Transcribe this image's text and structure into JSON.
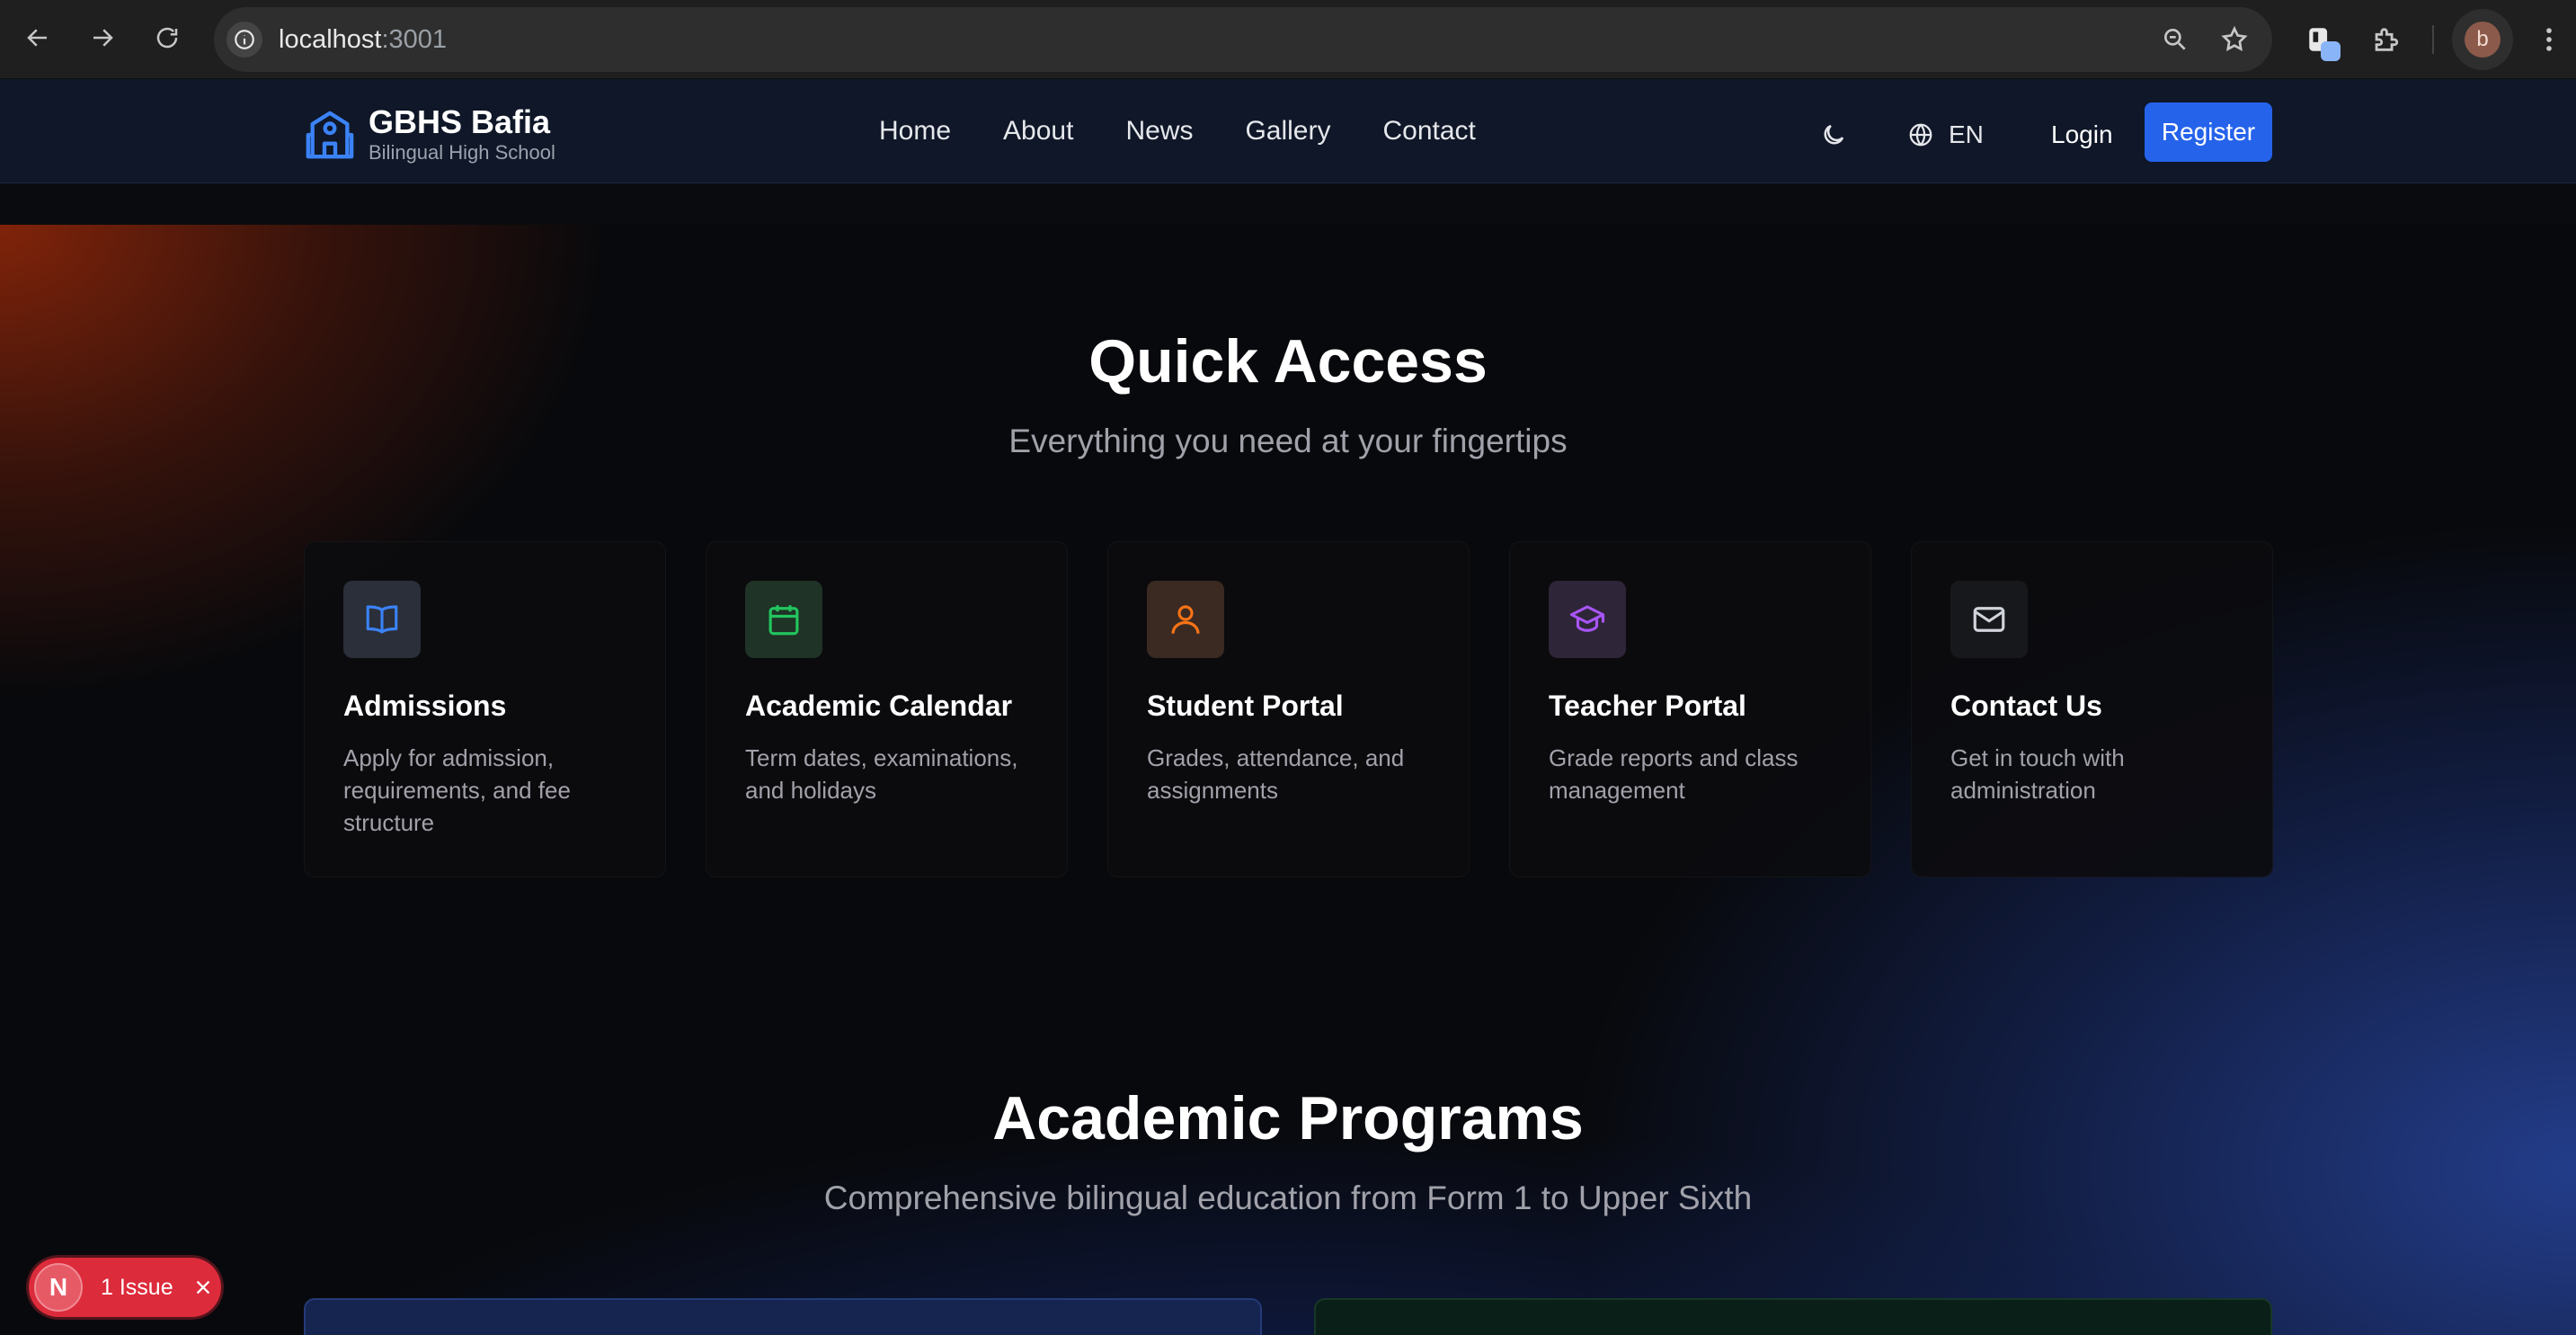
{
  "browser": {
    "url_host": "localhost",
    "url_port": ":3001",
    "profile_initial": "b"
  },
  "header": {
    "brand_name": "GBHS Bafia",
    "brand_subtitle": "Bilingual High School",
    "nav": [
      "Home",
      "About",
      "News",
      "Gallery",
      "Contact"
    ],
    "language": "EN",
    "login_label": "Login",
    "register_label": "Register",
    "register_color": "#2563eb"
  },
  "quick_access": {
    "title": "Quick Access",
    "subtitle": "Everything you need at your fingertips",
    "cards": [
      {
        "title": "Admissions",
        "description": "Apply for admission, requirements, and fee structure",
        "icon": "book-icon",
        "accent": "#3b82f6"
      },
      {
        "title": "Academic Calendar",
        "description": "Term dates, examinations, and holidays",
        "icon": "calendar-icon",
        "accent": "#22c55e"
      },
      {
        "title": "Student Portal",
        "description": "Grades, attendance, and assignments",
        "icon": "user-icon",
        "accent": "#f97316"
      },
      {
        "title": "Teacher Portal",
        "description": "Grade reports and class management",
        "icon": "graduation-cap-icon",
        "accent": "#a855f7"
      },
      {
        "title": "Contact Us",
        "description": "Get in touch with administration",
        "icon": "mail-icon",
        "accent": "#9ca3af"
      }
    ]
  },
  "academic_programs": {
    "title": "Academic Programs",
    "subtitle": "Comprehensive bilingual education from Form 1 to Upper Sixth"
  },
  "dev_overlay": {
    "logo_letter": "N",
    "issue_text": "1 Issue"
  }
}
